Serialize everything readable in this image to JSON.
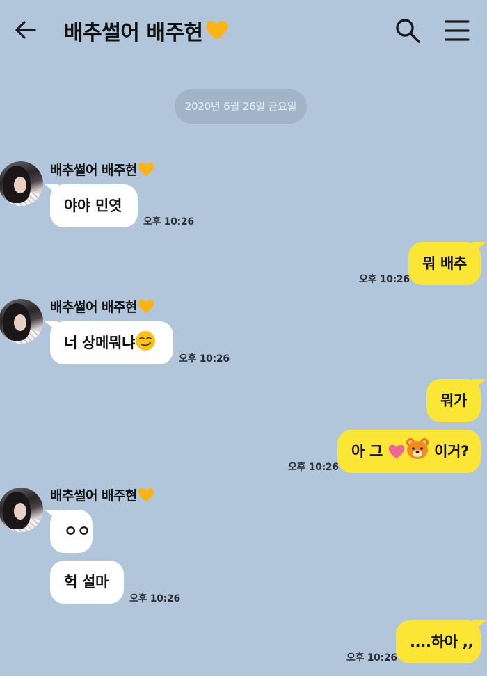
{
  "header": {
    "title": "배추썰어 배주현",
    "accent_color": "#fbb414"
  },
  "date_divider": "2020년 6월 26일 금요일",
  "messages": [
    {
      "sender": "배추썰어 배주현",
      "text": "야야 민엿",
      "time": "오후 10:26",
      "direction": "incoming"
    },
    {
      "text": "뭐 배추",
      "time": "오후 10:26",
      "direction": "outgoing"
    },
    {
      "sender": "배추썰어 배주현",
      "text": "너 상메뭐냐",
      "emoji": "smirking-face",
      "time": "오후 10:26",
      "direction": "incoming"
    },
    {
      "text": "뭐가",
      "direction": "outgoing"
    },
    {
      "text_before": "아 그",
      "emojis": [
        "pink-heart",
        "bear-face"
      ],
      "text_after": "이거?",
      "time": "오후 10:26",
      "direction": "outgoing"
    },
    {
      "sender": "배추썰어 배주현",
      "text": "ㅇㅇ",
      "direction": "incoming"
    },
    {
      "text": "헉 설마",
      "time": "오후 10:26",
      "direction": "incoming"
    },
    {
      "text": "....하아 ,,",
      "time": "오후 10:26",
      "direction": "outgoing"
    }
  ],
  "colors": {
    "background": "#b1c6da",
    "incoming_bubble": "#ffffff",
    "outgoing_bubble": "#fbe635",
    "date_pill": "#a1b4c8"
  },
  "icons": [
    "back-arrow-icon",
    "search-icon",
    "menu-icon",
    "yellow-heart-icon",
    "smirk-emoji-icon",
    "pink-heart-icon",
    "bear-face-icon"
  ]
}
